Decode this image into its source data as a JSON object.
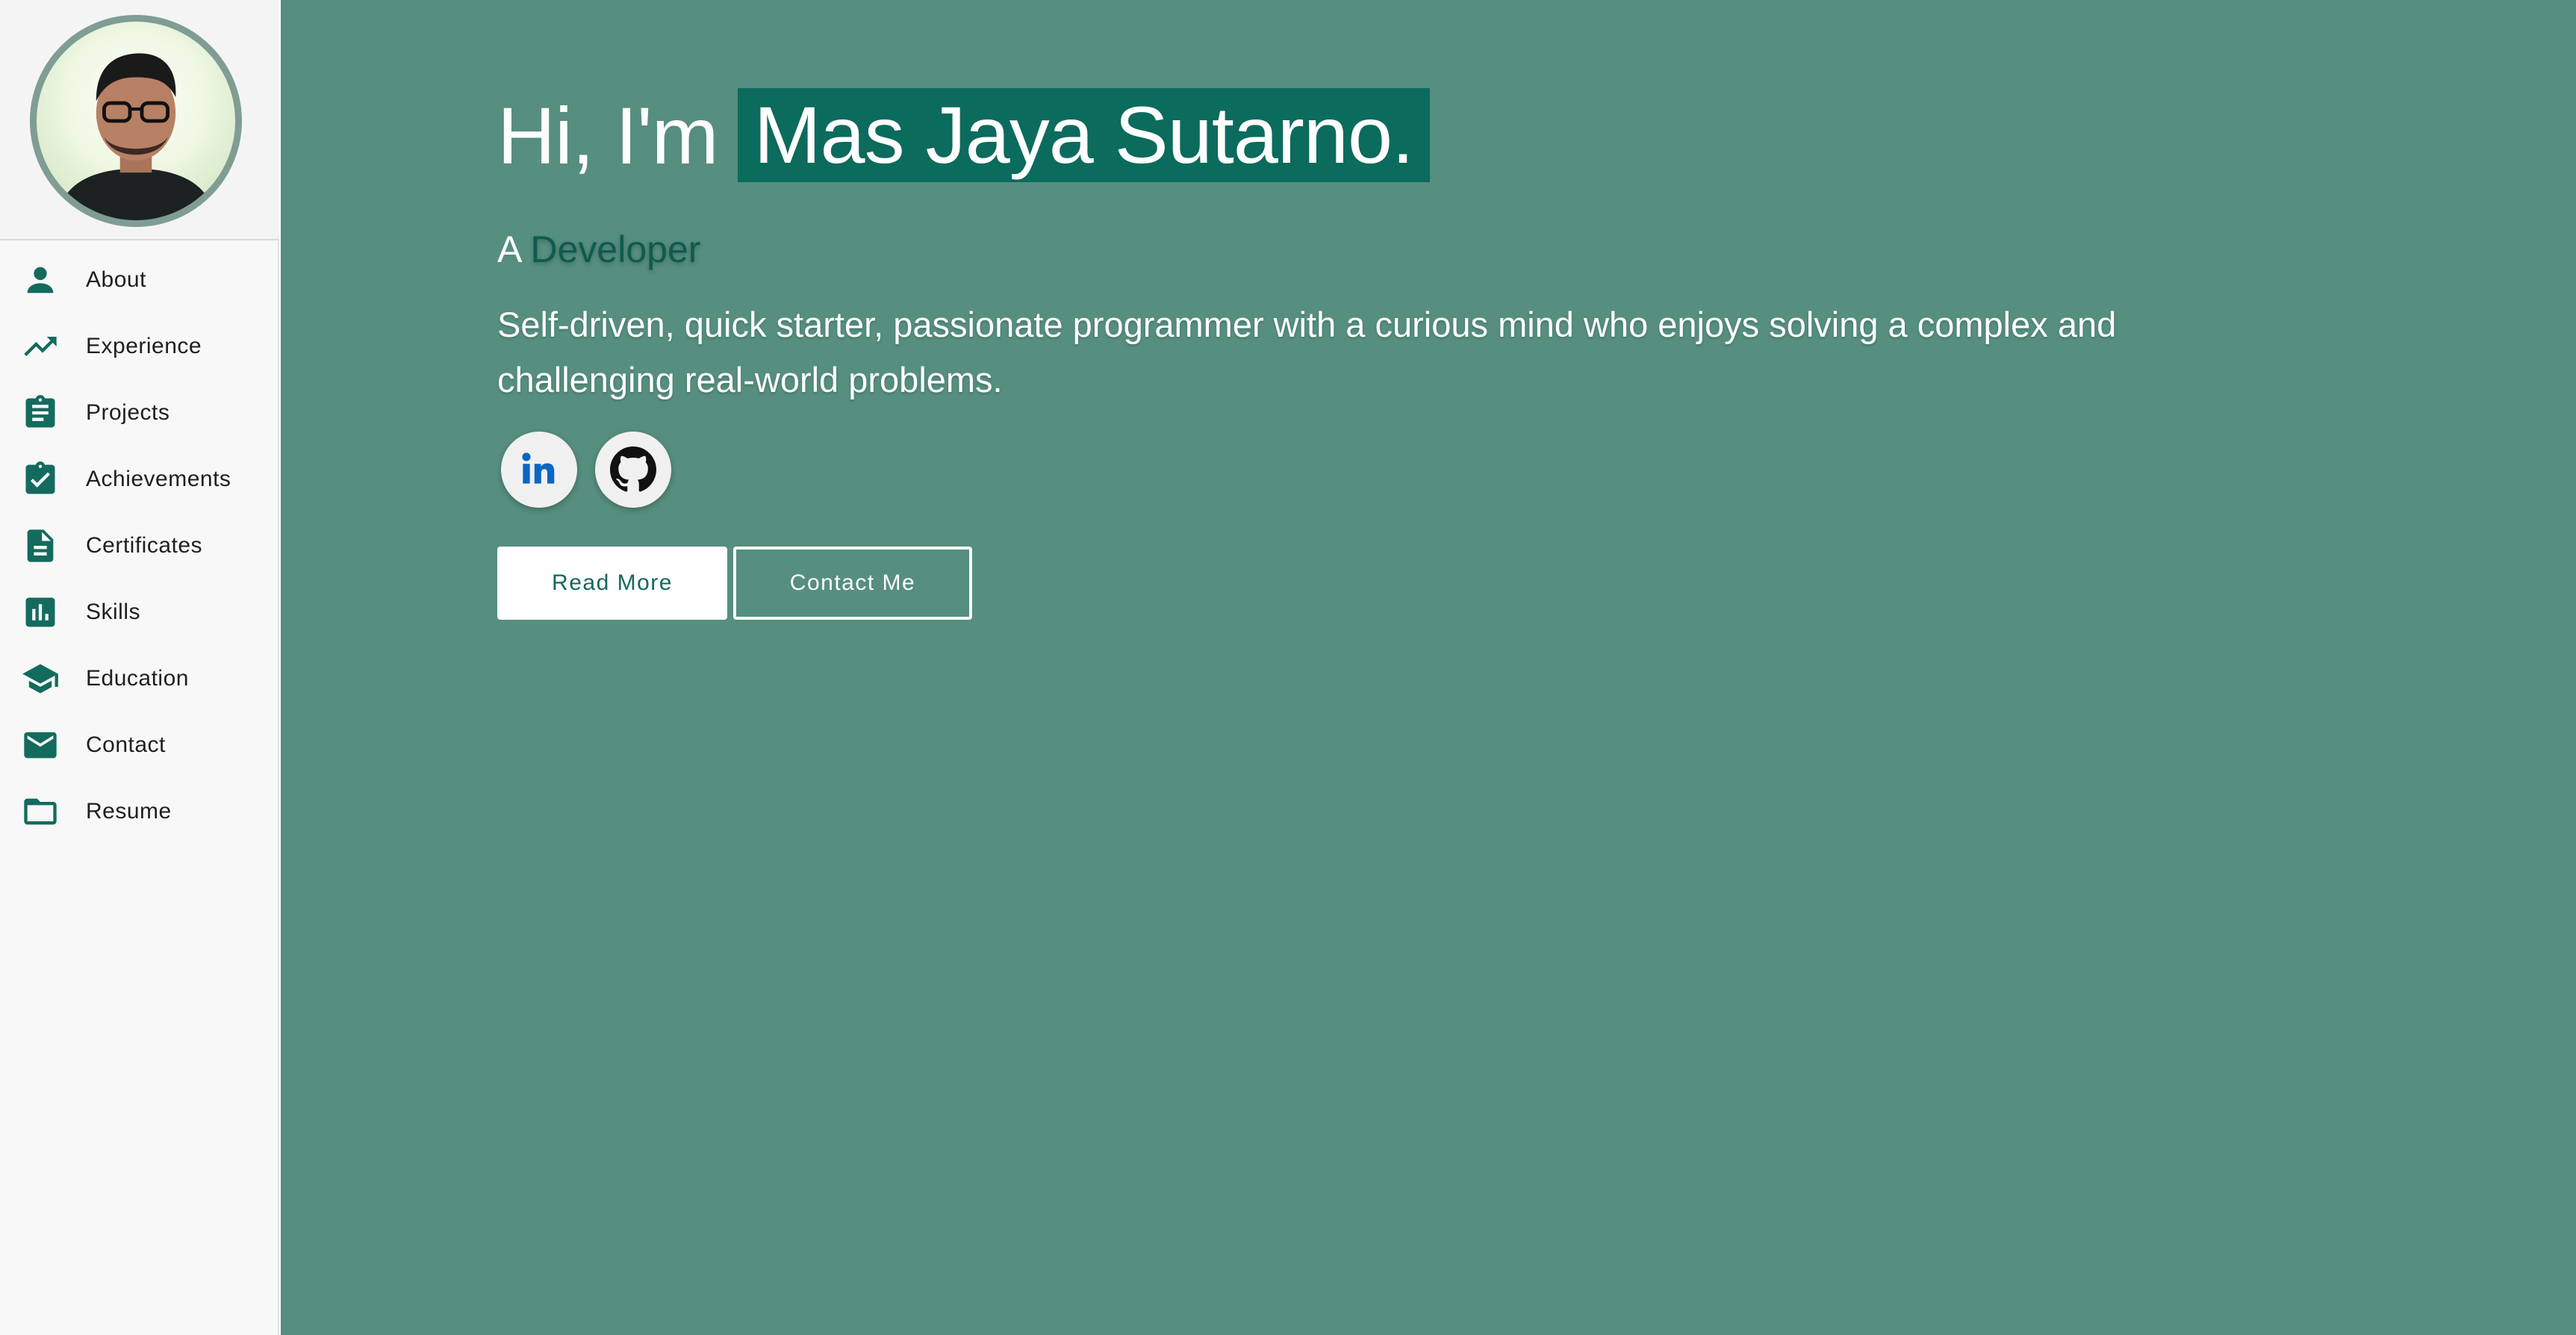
{
  "sidebar": {
    "items": [
      {
        "label": "About",
        "icon": "person-icon"
      },
      {
        "label": "Experience",
        "icon": "trending-up-icon"
      },
      {
        "label": "Projects",
        "icon": "clipboard-list-icon"
      },
      {
        "label": "Achievements",
        "icon": "clipboard-check-icon"
      },
      {
        "label": "Certificates",
        "icon": "document-icon"
      },
      {
        "label": "Skills",
        "icon": "bar-chart-icon"
      },
      {
        "label": "Education",
        "icon": "graduation-cap-icon"
      },
      {
        "label": "Contact",
        "icon": "mail-icon"
      },
      {
        "label": "Resume",
        "icon": "folder-icon"
      }
    ]
  },
  "hero": {
    "greeting": "Hi, I'm",
    "name": "Mas Jaya Sutarno.",
    "role_prefix": "A",
    "role": "Developer",
    "bio": "Self-driven, quick starter, passionate programmer with a curious mind who enjoys solving a complex and challenging real-world problems."
  },
  "social": [
    {
      "icon": "linkedin-icon"
    },
    {
      "icon": "github-icon"
    }
  ],
  "buttons": {
    "read_more": "Read More",
    "contact_me": "Contact Me"
  },
  "colors": {
    "main_background": "#568e7f",
    "accent": "#136b5e",
    "name_highlight": "#0b6b5c",
    "sidebar_background": "#f8f8f8"
  }
}
